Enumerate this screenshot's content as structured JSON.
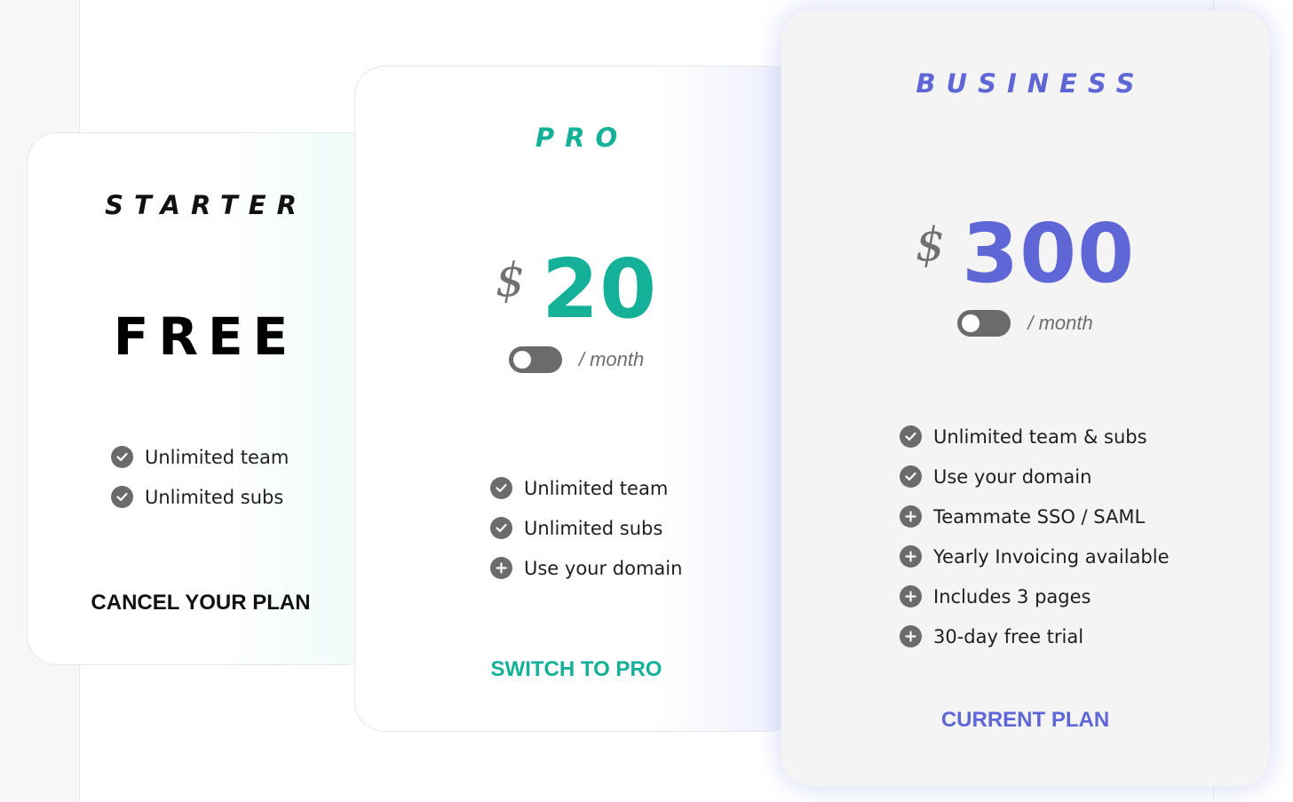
{
  "colors": {
    "starter": "#111111",
    "pro": "#14b097",
    "business": "#5f66d6",
    "muted": "#707070"
  },
  "plans": {
    "starter": {
      "name": "STARTER",
      "price": "FREE",
      "features": [
        {
          "icon": "check-icon",
          "label": "Unlimited team"
        },
        {
          "icon": "check-icon",
          "label": "Unlimited subs"
        }
      ],
      "action": "CANCEL YOUR PLAN"
    },
    "pro": {
      "name": "PRO",
      "currency": "$",
      "amount": "20",
      "period": "/ month",
      "features": [
        {
          "icon": "check-icon",
          "label": "Unlimited team"
        },
        {
          "icon": "check-icon",
          "label": "Unlimited subs"
        },
        {
          "icon": "plus-icon",
          "label": "Use your domain"
        }
      ],
      "action": "SWITCH TO PRO"
    },
    "business": {
      "name": "BUSINESS",
      "currency": "$",
      "amount": "300",
      "period": "/ month",
      "features": [
        {
          "icon": "check-icon",
          "label": "Unlimited team & subs"
        },
        {
          "icon": "check-icon",
          "label": "Use your domain"
        },
        {
          "icon": "plus-icon",
          "label": "Teammate SSO / SAML"
        },
        {
          "icon": "plus-icon",
          "label": "Yearly Invoicing available"
        },
        {
          "icon": "plus-icon",
          "label": "Includes 3 pages"
        },
        {
          "icon": "plus-icon",
          "label": "30-day free trial"
        }
      ],
      "action": "CURRENT PLAN"
    }
  }
}
